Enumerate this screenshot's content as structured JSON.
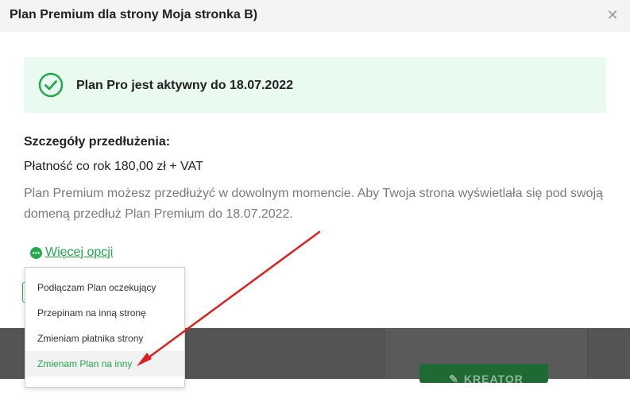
{
  "modal": {
    "title": "Plan Premium dla strony Moja stronka B)",
    "close_icon": "close-icon"
  },
  "banner": {
    "icon": "check-circle-icon",
    "text": "Plan Pro jest aktywny do 18.07.2022",
    "color": "#22aa4a"
  },
  "details": {
    "title": "Szczegóły przedłużenia:",
    "payment": "Płatność co rok 180,00 zł + VAT",
    "description": "Plan Premium możesz przedłużyć w dowolnym momencie. Aby Twoja strona wyświetlała się pod swoją domeną przedłuż Plan Premium do 18.07.2022."
  },
  "more_options": {
    "icon": "more-dots-icon",
    "label": "Więcej opcji"
  },
  "dropdown": {
    "items": [
      {
        "label": "Podłączam Plan oczekujący"
      },
      {
        "label": "Przepinam na inną stronę"
      },
      {
        "label": "Zmieniam płatnika strony"
      },
      {
        "label": "Zmienam Plan na inny"
      }
    ],
    "highlighted_index": 3
  },
  "background": {
    "kreator_label": "KREATOR",
    "kreator_icon": "pencil-icon"
  },
  "annotation": {
    "arrow_color": "#e0201e"
  }
}
